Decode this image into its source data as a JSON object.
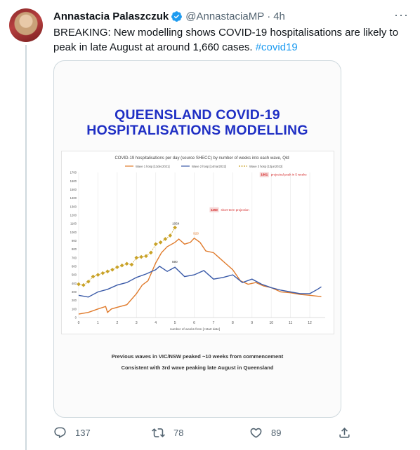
{
  "tweet": {
    "author_name": "Annastacia Palaszczuk",
    "handle": "@AnnastaciaMP",
    "separator": "·",
    "time": "4h",
    "text_main": "BREAKING: New modelling shows COVID-19 hospitalisations are likely to peak in late August at around 1,660 cases.",
    "hashtag": "#covid19"
  },
  "media": {
    "title_line1": "QUEENSLAND COVID-19",
    "title_line2": "HOSPITALISATIONS MODELLING",
    "footer_line1": "Previous waves in VIC/NSW peaked ~10 weeks from commencement",
    "footer_line2": "Consistent with 3rd wave peaking late August in Queensland"
  },
  "actions": {
    "replies": "137",
    "retweets": "78",
    "likes": "89"
  },
  "colors": {
    "accent": "#1d9bf0",
    "title_blue": "#1f2fc4",
    "wave1": "#e07b2c",
    "wave2": "#3a5aa8",
    "wave3": "#c9a227",
    "annotation": "#d62b2b"
  },
  "chart_data": {
    "type": "line",
    "title": "COVID-19 hospitalisations per day (source SHECC) by number of weeks into each wave, Qld",
    "xlabel": "number of weeks from [<start date]",
    "ylabel": "",
    "xlim": [
      0,
      12.8
    ],
    "ylim": [
      0,
      1700
    ],
    "x_ticks": [
      0,
      1,
      2,
      3,
      4,
      5,
      6,
      7,
      8,
      9,
      10,
      11,
      12
    ],
    "y_ticks": [
      0,
      100,
      200,
      300,
      400,
      500,
      600,
      700,
      800,
      900,
      1000,
      1100,
      1200,
      1300,
      1400,
      1500,
      1600,
      1700
    ],
    "grid": true,
    "legend_position": "top",
    "series": [
      {
        "name": "Wave 1 hosp [13dec2021]",
        "x": [
          0,
          0.5,
          1,
          1.4,
          1.5,
          1.7,
          2,
          2.5,
          3,
          3.3,
          3.6,
          4,
          4.3,
          4.6,
          5,
          5.2,
          5.5,
          5.8,
          6,
          6.3,
          6.6,
          7,
          7.3,
          7.6,
          8,
          8.4,
          8.8,
          9.2,
          9.6,
          10,
          10.5,
          11,
          11.5,
          12,
          12.6
        ],
        "y": [
          40,
          60,
          100,
          130,
          60,
          100,
          120,
          150,
          280,
          380,
          430,
          640,
          760,
          830,
          880,
          920,
          860,
          880,
          930,
          880,
          780,
          760,
          700,
          640,
          560,
          430,
          390,
          410,
          370,
          350,
          300,
          290,
          270,
          260,
          245
        ]
      },
      {
        "name": "Wave 2 hosp [14mar2022]",
        "x": [
          0,
          0.5,
          1,
          1.5,
          2,
          2.5,
          3,
          3.5,
          4,
          4.2,
          4.6,
          5,
          5.5,
          6,
          6.5,
          7,
          7.5,
          8,
          8.5,
          9,
          9.5,
          10,
          10.5,
          11,
          11.5,
          12,
          12.4,
          12.6
        ],
        "y": [
          260,
          240,
          300,
          330,
          380,
          410,
          470,
          510,
          560,
          600,
          540,
          590,
          480,
          500,
          550,
          450,
          470,
          500,
          410,
          450,
          390,
          350,
          320,
          300,
          280,
          280,
          330,
          360
        ]
      },
      {
        "name": "Wave 3 hosp [13jun2022]",
        "x": [
          0,
          0.25,
          0.5,
          0.75,
          1,
          1.25,
          1.5,
          1.75,
          2,
          2.25,
          2.5,
          2.75,
          3,
          3.25,
          3.5,
          3.75,
          4,
          4.25,
          4.5,
          4.75,
          5
        ],
        "y": [
          390,
          380,
          420,
          480,
          500,
          520,
          540,
          560,
          590,
          610,
          630,
          620,
          700,
          710,
          720,
          760,
          860,
          880,
          920,
          960,
          1054
        ]
      }
    ],
    "data_labels": [
      {
        "text": "1054",
        "series": "Wave 3 hosp [13jun2022]"
      },
      {
        "text": "928",
        "series": "Wave 1 hosp [13dec2021]"
      },
      {
        "text": "590",
        "series": "Wave 2 hosp [14mar2022]"
      }
    ],
    "annotations": [
      {
        "box": "1661",
        "text": "projected peak in 5 weeks"
      },
      {
        "box": "1250",
        "text": "short-term projection"
      }
    ]
  }
}
